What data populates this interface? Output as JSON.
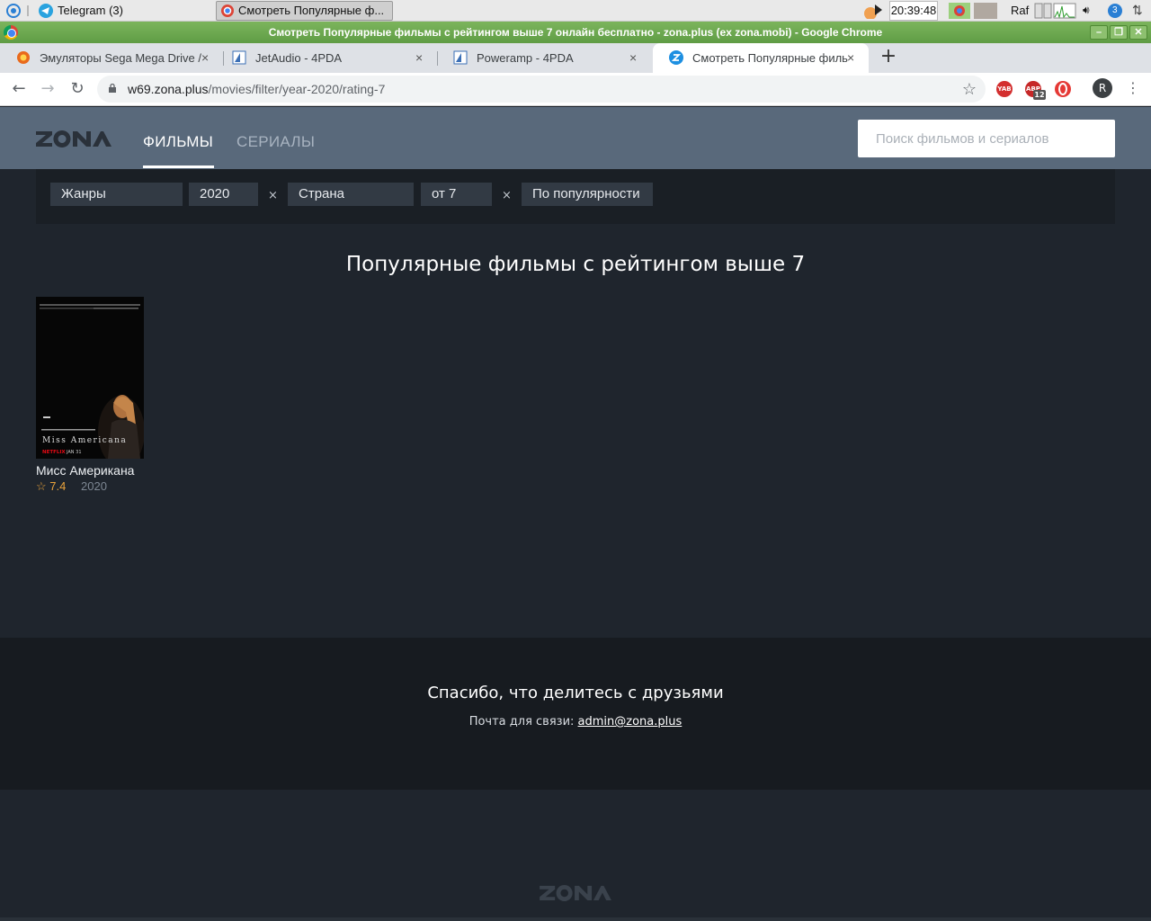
{
  "taskbar": {
    "telegram_label": "Telegram (3)",
    "active_window": "Смотреть Популярные ф...",
    "clock": "20:39:48",
    "user": "Raf",
    "notification_count": "3"
  },
  "window": {
    "title": "Смотреть Популярные фильмы с рейтингом выше 7 онлайн бесплатно - zona.plus (ex zona.mobi) - Google Chrome"
  },
  "tabs": [
    {
      "label": "Эмуляторы Sega Mega Drive /",
      "close": "×"
    },
    {
      "label": "JetAudio - 4PDA",
      "close": "×"
    },
    {
      "label": "Poweramp - 4PDA",
      "close": "×"
    },
    {
      "label": "Смотреть Популярные филь",
      "close": "×"
    }
  ],
  "address": {
    "host": "w69.zona.plus",
    "path": "/movies/filter/year-2020/rating-7"
  },
  "extensions": {
    "yab": "YAB",
    "abp": "ABP",
    "abp_count": "12",
    "avatar": "R"
  },
  "site": {
    "nav": {
      "films": "ФИЛЬМЫ",
      "series": "СЕРИАЛЫ"
    },
    "search_placeholder": "Поиск фильмов и сериалов"
  },
  "filters": {
    "genres": "Жанры",
    "year": "2020",
    "country": "Страна",
    "rating": "от 7",
    "sort": "По популярности",
    "clear": "×"
  },
  "page_title": "Популярные фильмы с рейтингом выше 7",
  "movies": [
    {
      "title": "Мисс Американа",
      "rating": "☆ 7.4",
      "year": "2020",
      "poster_title": "Miss Americana",
      "poster_brand": "NETFLIX",
      "poster_date": "JAN 31"
    }
  ],
  "footer": {
    "thanks": "Спасибо, что делитесь с друзьями",
    "contact_label": "Почта для связи:",
    "contact_email": "admin@zona.plus"
  },
  "colors": {
    "header_bg": "#59697b",
    "page_bg": "#1f252d",
    "footer_bg": "#171b20",
    "rating_accent": "#e8a23b",
    "titlebar_green": "#6aa84f"
  }
}
